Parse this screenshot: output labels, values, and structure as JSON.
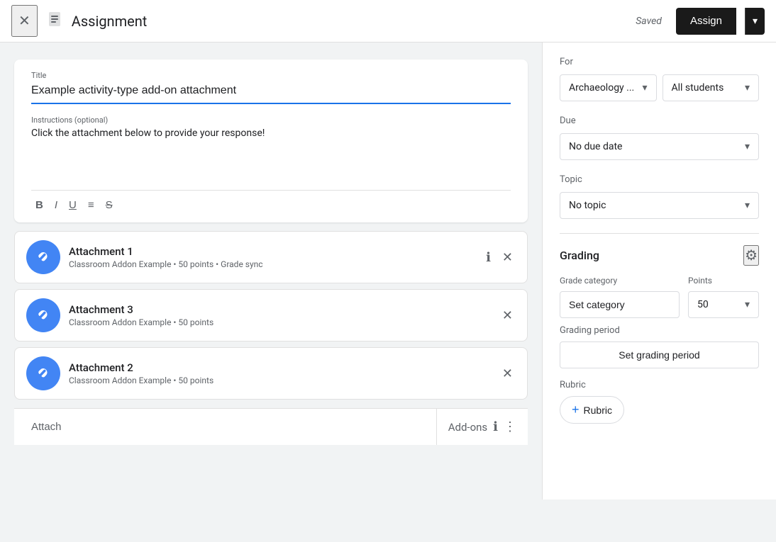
{
  "topbar": {
    "title": "Assignment",
    "saved_label": "Saved",
    "assign_label": "Assign",
    "close_icon": "✕",
    "doc_icon": "📋",
    "arrow_icon": "▾"
  },
  "form": {
    "title_label": "Title",
    "title_value": "Example activity-type add-on attachment",
    "instructions_label": "Instructions (optional)",
    "instructions_text": "Click the attachment below to provide your response!",
    "toolbar": {
      "bold": "B",
      "italic": "I",
      "underline": "U",
      "list": "≡",
      "strikethrough": "S̶"
    }
  },
  "attachments": [
    {
      "name": "Attachment 1",
      "sub": "Classroom Addon Example • 50 points • Grade sync",
      "icon": "🤝"
    },
    {
      "name": "Attachment 3",
      "sub": "Classroom Addon Example • 50 points",
      "icon": "🤝"
    },
    {
      "name": "Attachment 2",
      "sub": "Classroom Addon Example • 50 points",
      "icon": "🤝"
    }
  ],
  "bottom_bar": {
    "attach_label": "Attach",
    "addons_label": "Add-ons",
    "info_icon": "ℹ",
    "more_icon": "⋮"
  },
  "right_panel": {
    "for_label": "For",
    "class_value": "Archaeology ...",
    "students_value": "All students",
    "due_label": "Due",
    "due_value": "No due date",
    "topic_label": "Topic",
    "topic_value": "No topic",
    "grading_title": "Grading",
    "grade_category_label": "Grade category",
    "points_label": "Points",
    "set_category_label": "Set category",
    "points_value": "50",
    "grading_period_label": "Grading period",
    "set_grading_period_label": "Set grading period",
    "rubric_label": "Rubric",
    "add_rubric_label": "Rubric",
    "settings_icon": "⚙",
    "arrow_icon": "▾",
    "plus_icon": "+"
  }
}
